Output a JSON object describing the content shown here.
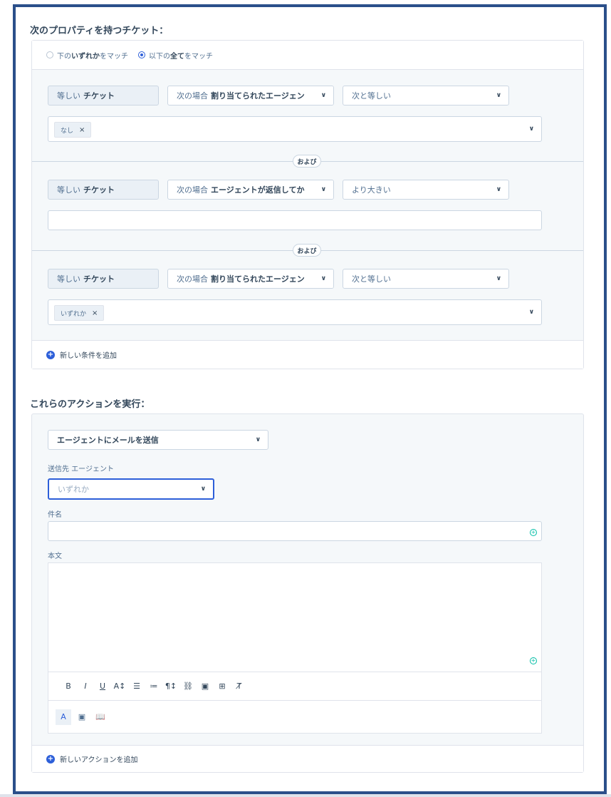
{
  "conditions_title": "次のプロパティを持つチケット：",
  "match": {
    "any_prefix": "下の",
    "any_bold": "いずれか",
    "any_suffix": "をマッチ",
    "all_prefix": "以下の",
    "all_bold": "全て",
    "all_suffix": "をマッチ",
    "selected": "all"
  },
  "conditions": [
    {
      "object_prefix": "等しい",
      "object_bold": "チケット",
      "prop_prefix": "次の場合",
      "prop_bold": "割り当てられたエージェン",
      "operator": "次と等しい",
      "value_tag": "なし",
      "value_tag_remove": "×",
      "value_text": ""
    },
    {
      "object_prefix": "等しい",
      "object_bold": "チケット",
      "prop_prefix": "次の場合",
      "prop_bold": "エージェントが返信してか",
      "operator": "より大きい",
      "value_tag": "",
      "value_tag_remove": "",
      "value_text": ""
    },
    {
      "object_prefix": "等しい",
      "object_bold": "チケット",
      "prop_prefix": "次の場合",
      "prop_bold": "割り当てられたエージェン",
      "operator": "次と等しい",
      "value_tag": "いずれか",
      "value_tag_remove": "×",
      "value_text": ""
    }
  ],
  "and_label": "および",
  "add_condition": "新しい条件を追加",
  "actions_title": "これらのアクションを実行：",
  "action": {
    "type_value": "エージェントにメールを送信",
    "recipient_label": "送信先 エージェント",
    "recipient_placeholder": "いずれか",
    "subject_label": "件名",
    "subject_value": "",
    "body_label": "本文",
    "body_value": ""
  },
  "toolbar": [
    "B",
    "I",
    "U",
    "A↕",
    "☰",
    "≔",
    "¶↕",
    "⛓",
    "▣",
    "⊞",
    "T̸"
  ],
  "toolbar2": [
    "A",
    "▣",
    "📖"
  ],
  "add_action": "新しいアクションを追加",
  "colors": {
    "frame": "#2b4f8a",
    "accent": "#2d5fd9",
    "green": "#00bda5"
  }
}
